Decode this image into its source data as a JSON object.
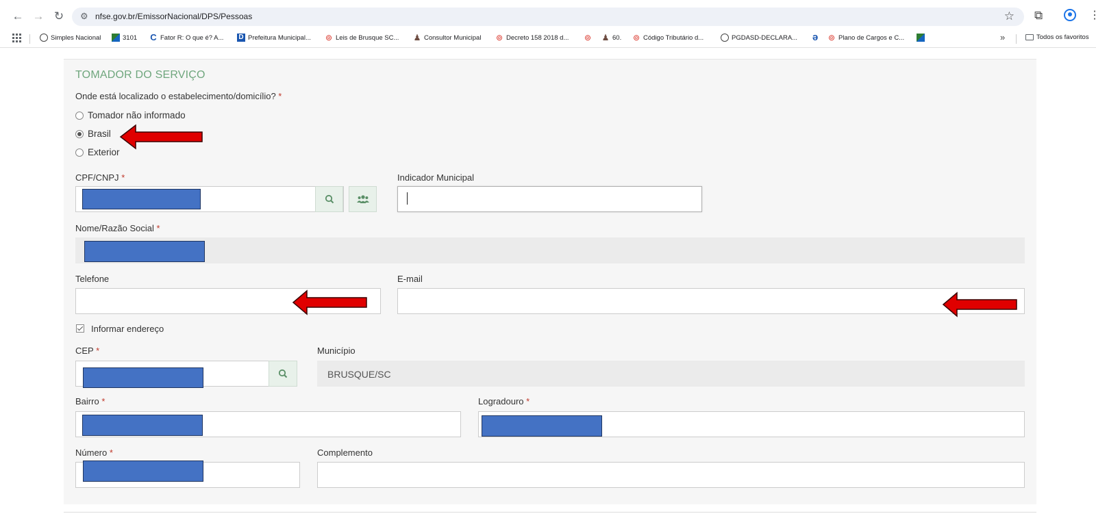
{
  "browser": {
    "url": "nfse.gov.br/EmissorNacional/DPS/Pessoas",
    "bookmarks": [
      {
        "label": "Simples Nacional",
        "icon": "globe-icon"
      },
      {
        "label": "3101",
        "icon": "flag-icon"
      },
      {
        "label": "Fator R: O que é? A...",
        "icon": "c-logo-icon"
      },
      {
        "label": "Prefeitura Municipal...",
        "icon": "d-logo-icon"
      },
      {
        "label": "Leis de Brusque SC...",
        "icon": "red-logo-icon"
      },
      {
        "label": "Consultor Municipal",
        "icon": "person-icon"
      },
      {
        "label": "Decreto 158 2018 d...",
        "icon": "red-logo-icon"
      },
      {
        "label": "",
        "icon": "red-logo-icon"
      },
      {
        "label": "60.",
        "icon": "person-icon"
      },
      {
        "label": "Código Tributário d...",
        "icon": "red-logo-icon"
      },
      {
        "label": "PGDASD-DECLARA...",
        "icon": "globe-icon"
      },
      {
        "label": "",
        "icon": "a-logo-icon"
      },
      {
        "label": "Plano de Cargos e C...",
        "icon": "red-logo-icon"
      },
      {
        "label": "",
        "icon": "flag-icon"
      }
    ],
    "all_bookmarks": "Todos os favoritos"
  },
  "form": {
    "section_title": "TOMADOR DO SERVIÇO",
    "location_question": "Onde está localizado o estabelecimento/domicílio?",
    "required_mark": "*",
    "radio_options": [
      {
        "label": "Tomador não informado",
        "selected": false
      },
      {
        "label": "Brasil",
        "selected": true
      },
      {
        "label": "Exterior",
        "selected": false
      }
    ],
    "cpf_cnpj_label": "CPF/CNPJ",
    "indicador_municipal_label": "Indicador Municipal",
    "nome_label": "Nome/Razão Social",
    "telefone_label": "Telefone",
    "email_label": "E-mail",
    "informar_endereco_label": "Informar endereço",
    "informar_endereco_checked": true,
    "cep_label": "CEP",
    "municipio_label": "Município",
    "municipio_value": "BRUSQUE/SC",
    "bairro_label": "Bairro",
    "logradouro_label": "Logradouro",
    "numero_label": "Número",
    "complemento_label": "Complemento"
  },
  "colors": {
    "section_title": "#6fa67d",
    "redaction": "#4472c4",
    "annotation_arrow": "#e00000",
    "required": "#c0392b"
  }
}
